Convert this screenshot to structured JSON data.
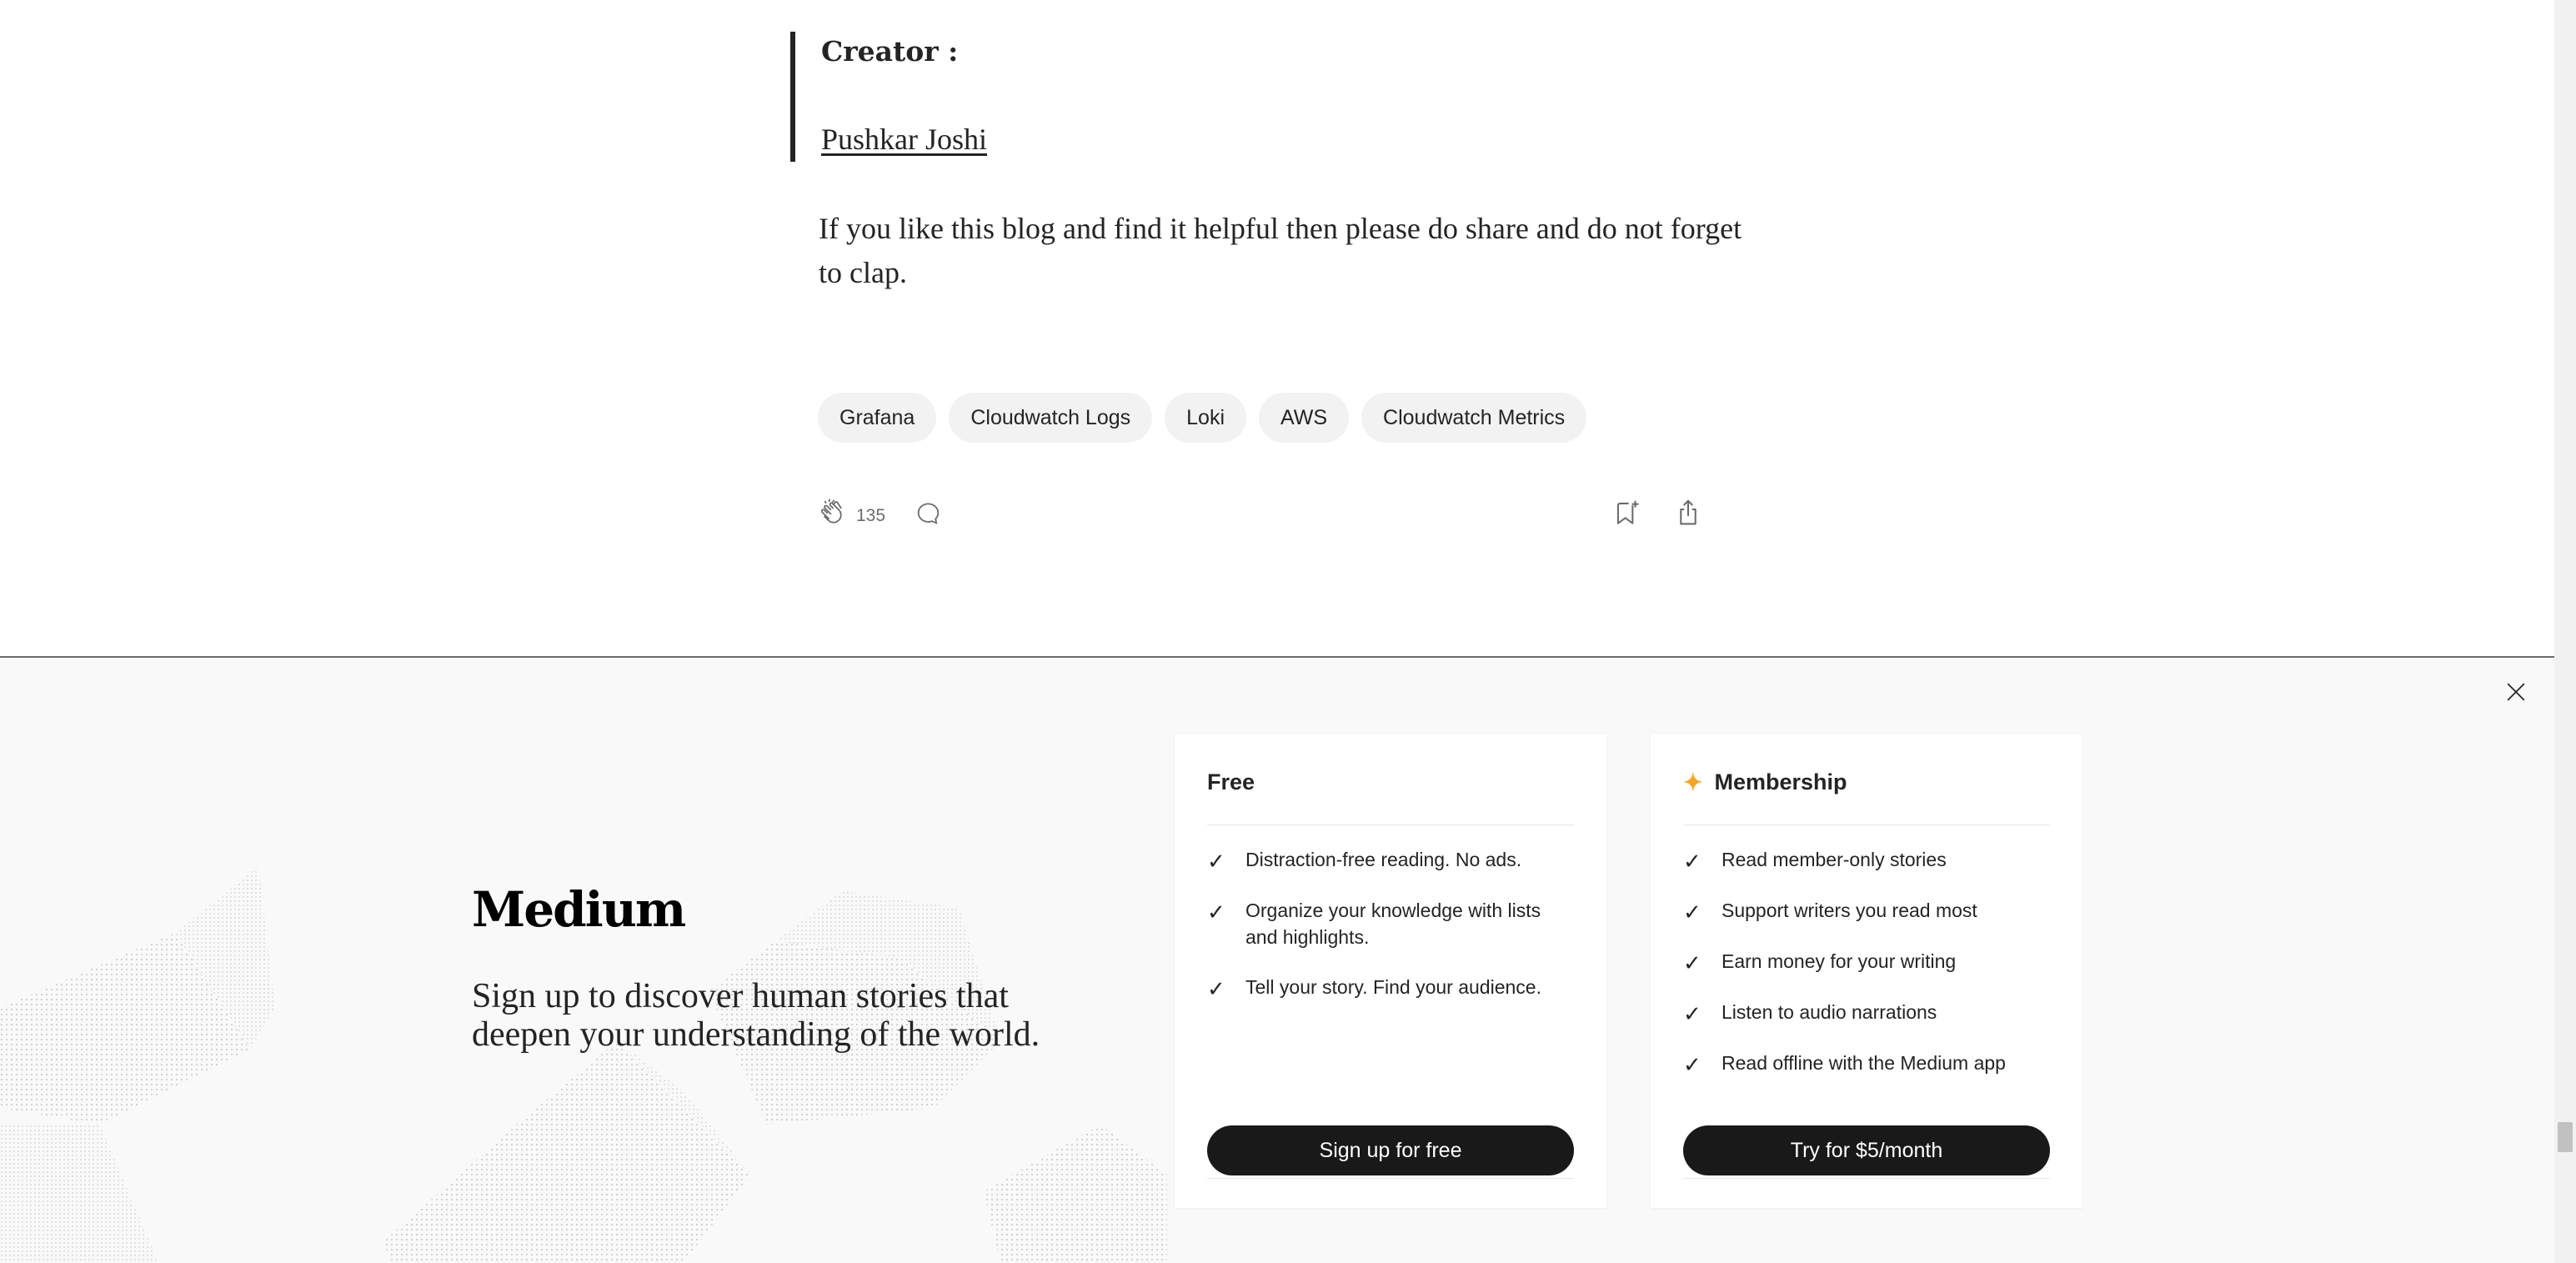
{
  "article": {
    "creator_label": "Creator :",
    "creator_name": "Pushkar Joshi",
    "closing_paragraph": "If you like this blog and find it helpful then please do share and do not forget to clap.",
    "tags": [
      "Grafana",
      "Cloudwatch Logs",
      "Loki",
      "AWS",
      "Cloudwatch Metrics"
    ],
    "clap_count": "135",
    "icons": {
      "clap": "clap-icon",
      "response": "comment-icon",
      "bookmark": "bookmark-add-icon",
      "share": "share-icon"
    }
  },
  "signup_overlay": {
    "logo": "Medium",
    "tagline": "Sign up to discover human stories that deepen your understanding of the world.",
    "close_icon": "close-icon",
    "free_card": {
      "title": "Free",
      "features": [
        "Distraction-free reading. No ads.",
        "Organize your knowledge with lists and highlights.",
        "Tell your story. Find your audience."
      ],
      "cta": "Sign up for free"
    },
    "membership_card": {
      "title": "Membership",
      "star_icon": "sparkle-icon",
      "features": [
        "Read member-only stories",
        "Support writers you read most",
        "Earn money for your writing",
        "Listen to audio narrations",
        "Read offline with the Medium app"
      ],
      "cta": "Try for $5/month"
    }
  },
  "colors": {
    "text": "#242424",
    "muted": "#6b6b6b",
    "tag_bg": "#f2f2f2",
    "overlay_bg": "#f9f9f9",
    "button_bg": "#191919",
    "accent_star": "#f5a623"
  }
}
